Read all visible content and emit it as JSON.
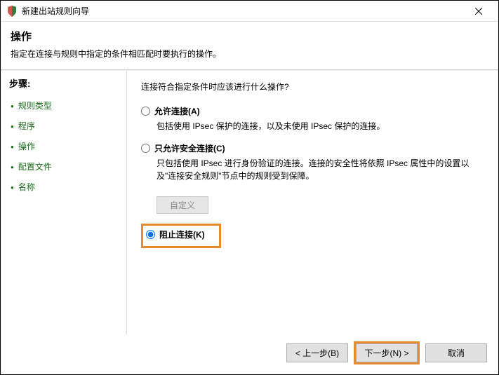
{
  "window": {
    "title": "新建出站规则向导"
  },
  "header": {
    "title": "操作",
    "subtitle": "指定在连接与规则中指定的条件相匹配时要执行的操作。"
  },
  "sidebar": {
    "steps_label": "步骤:",
    "items": [
      {
        "label": "规则类型"
      },
      {
        "label": "程序"
      },
      {
        "label": "操作"
      },
      {
        "label": "配置文件"
      },
      {
        "label": "名称"
      }
    ]
  },
  "content": {
    "question": "连接符合指定条件时应该进行什么操作?",
    "options": {
      "allow": {
        "label": "允许连接(A)",
        "desc": "包括使用 IPsec 保护的连接，以及未使用 IPsec 保护的连接。"
      },
      "secure": {
        "label": "只允许安全连接(C)",
        "desc": "只包括使用 IPsec 进行身份验证的连接。连接的安全性将依照 IPsec 属性中的设置以及\"连接安全规则\"节点中的规则受到保障。"
      },
      "block": {
        "label": "阻止连接(K)"
      }
    },
    "custom_button": "自定义"
  },
  "footer": {
    "back": "< 上一步(B)",
    "next": "下一步(N) >",
    "cancel": "取消"
  }
}
